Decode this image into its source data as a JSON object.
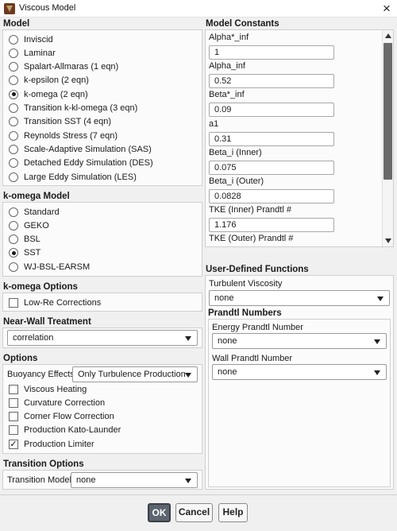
{
  "window": {
    "title": "Viscous Model"
  },
  "model": {
    "heading": "Model",
    "options": [
      "Inviscid",
      "Laminar",
      "Spalart-Allmaras (1 eqn)",
      "k-epsilon (2 eqn)",
      "k-omega (2 eqn)",
      "Transition k-kl-omega (3 eqn)",
      "Transition SST (4 eqn)",
      "Reynolds Stress (7 eqn)",
      "Scale-Adaptive Simulation (SAS)",
      "Detached Eddy Simulation (DES)",
      "Large Eddy Simulation (LES)"
    ],
    "selected": "k-omega (2 eqn)"
  },
  "komega_model": {
    "heading": "k-omega Model",
    "options": [
      "Standard",
      "GEKO",
      "BSL",
      "SST",
      "WJ-BSL-EARSM"
    ],
    "selected": "SST"
  },
  "komega_options": {
    "heading": "k-omega Options",
    "low_re": {
      "label": "Low-Re Corrections",
      "checked": false
    }
  },
  "near_wall": {
    "heading": "Near-Wall Treatment",
    "value": "correlation"
  },
  "options": {
    "heading": "Options",
    "buoyancy_label": "Buoyancy Effects",
    "buoyancy_value": "Only Turbulence Production",
    "checks": [
      {
        "label": "Viscous Heating",
        "checked": false
      },
      {
        "label": "Curvature Correction",
        "checked": false
      },
      {
        "label": "Corner Flow Correction",
        "checked": false
      },
      {
        "label": "Production Kato-Launder",
        "checked": false
      },
      {
        "label": "Production Limiter",
        "checked": true
      }
    ]
  },
  "transition": {
    "heading": "Transition Options",
    "label": "Transition Model",
    "value": "none"
  },
  "constants": {
    "heading": "Model Constants",
    "items": [
      {
        "label": "Alpha*_inf",
        "value": "1"
      },
      {
        "label": "Alpha_inf",
        "value": "0.52"
      },
      {
        "label": "Beta*_inf",
        "value": "0.09"
      },
      {
        "label": "a1",
        "value": "0.31"
      },
      {
        "label": "Beta_i (Inner)",
        "value": "0.075"
      },
      {
        "label": "Beta_i (Outer)",
        "value": "0.0828"
      },
      {
        "label": "TKE (Inner) Prandtl #",
        "value": "1.176"
      },
      {
        "label": "TKE (Outer) Prandtl #",
        "value": ""
      }
    ]
  },
  "udf": {
    "heading": "User-Defined Functions",
    "turb_visc_label": "Turbulent Viscosity",
    "turb_visc_value": "none",
    "prandtl_heading": "Prandtl Numbers",
    "energy_label": "Energy Prandtl Number",
    "energy_value": "none",
    "wall_label": "Wall Prandtl Number",
    "wall_value": "none"
  },
  "buttons": {
    "ok": "OK",
    "cancel": "Cancel",
    "help": "Help"
  },
  "icons": {
    "close": "close-icon",
    "app": "app-icon",
    "caret": "chevron-down-icon"
  },
  "colors": {
    "primary_button": "#5d6670",
    "background": "#f0f0f0"
  }
}
